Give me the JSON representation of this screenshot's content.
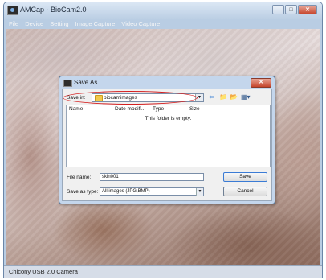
{
  "window": {
    "title": "AMCap - BioCam2.0",
    "min_glyph": "–",
    "max_glyph": "□",
    "close_glyph": "✕"
  },
  "menu": {
    "items": [
      "File",
      "Device",
      "Setting",
      "Image Capture",
      "Video Capture"
    ]
  },
  "status": {
    "text": "Chicony USB 2.0 Camera"
  },
  "dialog": {
    "title": "Save As",
    "close_glyph": "✕",
    "save_in_label": "Save in:",
    "save_in_value": "biocamimages",
    "combo_arrow": "▼",
    "toolbar_icons": [
      "back-arrow-icon",
      "up-folder-icon",
      "new-folder-icon",
      "view-menu-icon"
    ],
    "toolbar_glyphs": [
      "⇦",
      "📁",
      "📂",
      "▦▾"
    ],
    "columns": [
      "Name",
      "Date modifi...",
      "Type",
      "Size"
    ],
    "empty_message": "This folder is empty.",
    "file_name_label": "File name:",
    "file_name_value": "skin001",
    "save_as_type_label": "Save as type:",
    "save_as_type_value": "All images (JPG,BMP)",
    "save_button": "Save",
    "cancel_button": "Cancel"
  },
  "colors": {
    "window_frame": "#b9cde3",
    "dialog_frame": "#c4d6ec",
    "highlight_oval": "#d42020",
    "close_button": "#c7472e"
  }
}
